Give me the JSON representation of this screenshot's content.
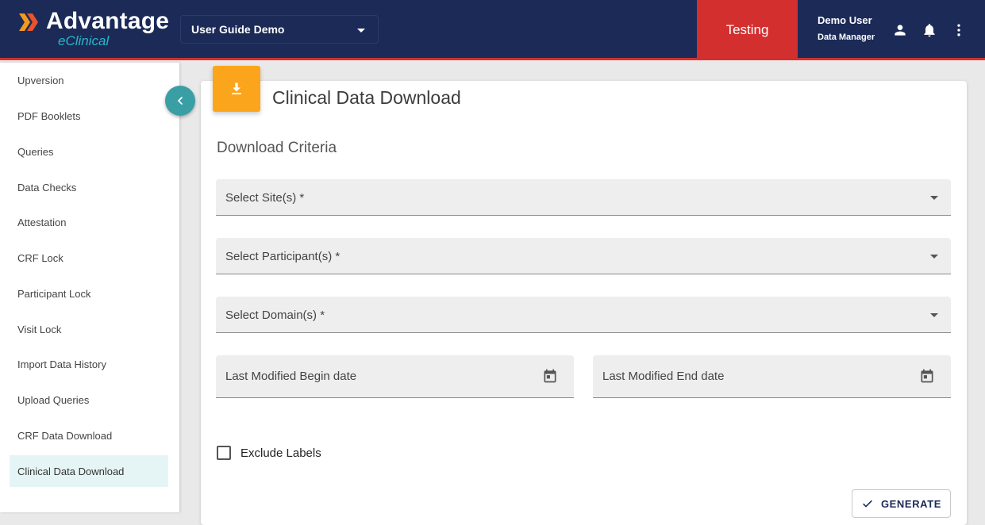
{
  "header": {
    "logo_main": "Advantage",
    "logo_sub": "eClinical",
    "study_select": "User Guide Demo",
    "environment": "Testing",
    "user_name": "Demo User",
    "user_role": "Data Manager",
    "icons": [
      "person-icon",
      "bell-icon",
      "more-vert-icon"
    ]
  },
  "sidebar": {
    "items": [
      {
        "label": "Upversion"
      },
      {
        "label": "PDF Booklets"
      },
      {
        "label": "Queries"
      },
      {
        "label": "Data Checks"
      },
      {
        "label": "Attestation"
      },
      {
        "label": "CRF Lock"
      },
      {
        "label": "Participant Lock"
      },
      {
        "label": "Visit Lock"
      },
      {
        "label": "Import Data History"
      },
      {
        "label": "Upload Queries"
      },
      {
        "label": "CRF Data Download"
      },
      {
        "label": "Clinical Data Download",
        "active": true
      }
    ]
  },
  "main": {
    "page_title": "Clinical Data Download",
    "section_title": "Download Criteria",
    "fields": {
      "sites": "Select Site(s) *",
      "participants": "Select Participant(s) *",
      "domains": "Select Domain(s) *",
      "begin_date": "Last Modified Begin date",
      "end_date": "Last Modified End date"
    },
    "exclude_labels": "Exclude Labels",
    "exclude_labels_checked": false,
    "generate_label": "GENERATE"
  },
  "colors": {
    "header_bg": "#1b2a57",
    "env_badge": "#d32f2f",
    "accent_teal": "#3a9ea5",
    "download_icon_bg": "#fba51d"
  }
}
